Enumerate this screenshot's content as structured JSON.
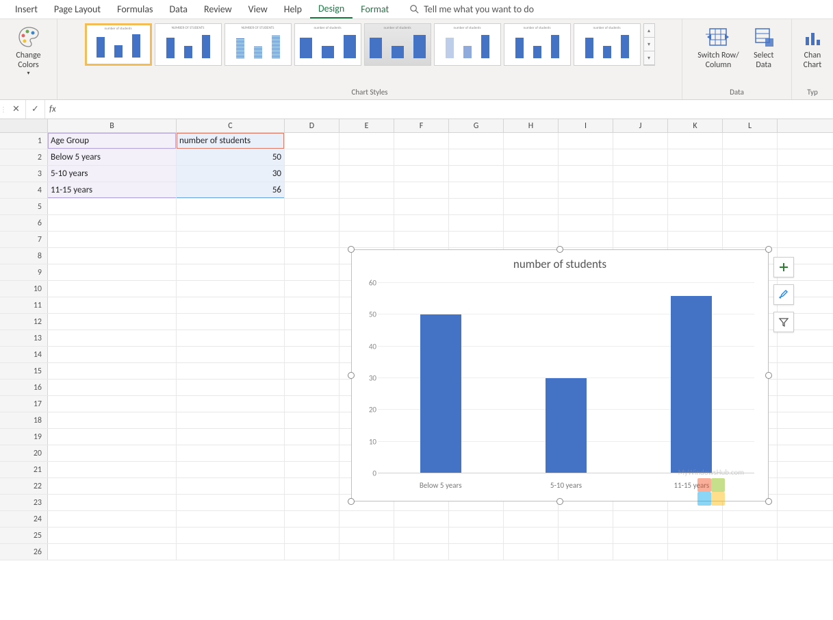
{
  "ribbon": {
    "tabs": [
      "Insert",
      "Page Layout",
      "Formulas",
      "Data",
      "Review",
      "View",
      "Help",
      "Design",
      "Format"
    ],
    "active_tab": "Design",
    "tellme": "Tell me what you want to do",
    "change_colors": "Change Colors",
    "chart_styles_label": "Chart Styles",
    "switch_row_col": "Switch Row/\nColumn",
    "select_data": "Select\nData",
    "data_label": "Data",
    "change_chart": "Chan\nChart",
    "type_label": "Typ"
  },
  "formula_bar": {
    "fx": "fx"
  },
  "grid": {
    "columns": [
      "B",
      "C",
      "D",
      "E",
      "F",
      "G",
      "H",
      "I",
      "J",
      "K",
      "L"
    ],
    "header_row": {
      "b": "Age Group",
      "c": "number of students"
    },
    "rows": [
      {
        "n": "1"
      },
      {
        "n": "2"
      },
      {
        "n": "3"
      },
      {
        "n": "4"
      },
      {
        "n": "5"
      },
      {
        "n": "6"
      },
      {
        "n": "7"
      },
      {
        "n": "8"
      },
      {
        "n": "9"
      },
      {
        "n": "10"
      },
      {
        "n": "11"
      },
      {
        "n": "12"
      },
      {
        "n": "13"
      },
      {
        "n": "14"
      },
      {
        "n": "15"
      },
      {
        "n": "16"
      },
      {
        "n": "17"
      },
      {
        "n": "18"
      },
      {
        "n": "19"
      },
      {
        "n": "20"
      },
      {
        "n": "21"
      },
      {
        "n": "22"
      },
      {
        "n": "23"
      },
      {
        "n": "24"
      },
      {
        "n": "25"
      },
      {
        "n": "26"
      }
    ],
    "data": {
      "r2b": "Below 5 years",
      "r2c": "50",
      "r3b": "5-10 years",
      "r3c": "30",
      "r4b": "11-15 years",
      "r4c": "56"
    }
  },
  "chart_data": {
    "type": "bar",
    "title": "number of students",
    "categories": [
      "Below 5 years",
      "5-10 years",
      "11-15 years"
    ],
    "values": [
      50,
      30,
      56
    ],
    "ylim": [
      0,
      60
    ],
    "yticks": [
      0,
      10,
      20,
      30,
      40,
      50,
      60
    ],
    "xlabel": "",
    "ylabel": ""
  },
  "watermark": "MyWindowsHub.com"
}
